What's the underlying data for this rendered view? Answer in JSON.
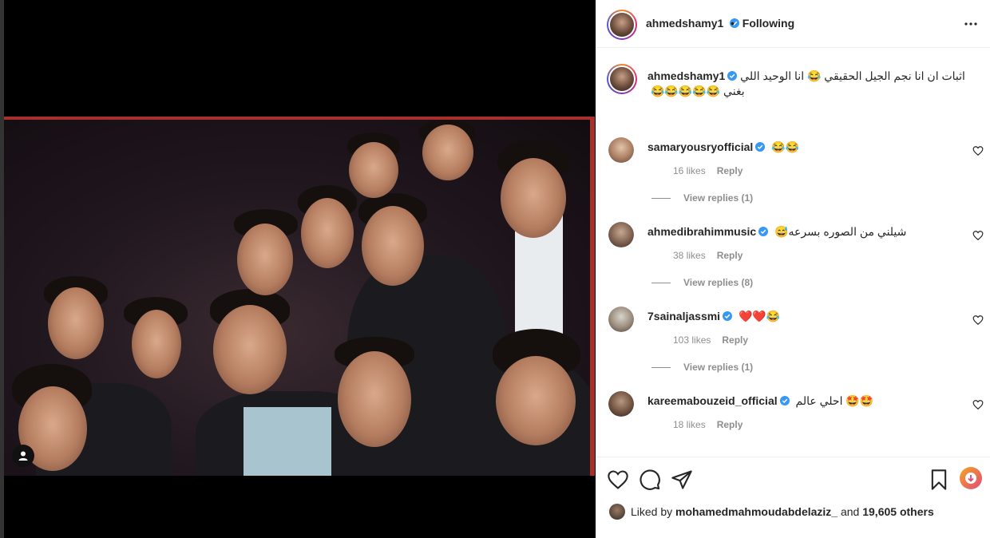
{
  "post": {
    "username": "ahmedshamy1",
    "follow_status": "Following",
    "separator": "•",
    "caption": "اثبات ان انا نجم الجيل الحقيقي 😂 انا الوحيد اللي بغني 😂😂😂😂😂"
  },
  "comments": [
    {
      "username": "samaryousryofficial",
      "text": "😂😂",
      "likes": "16 likes",
      "reply": "Reply",
      "replies": "View replies (1)"
    },
    {
      "username": "ahmedibrahimmusic",
      "text": "شيلني من الصوره بسرعه😅",
      "likes": "38 likes",
      "reply": "Reply",
      "replies": "View replies (8)"
    },
    {
      "username": "7sainaljassmi",
      "text": "❤️❤️😂",
      "likes": "103 likes",
      "reply": "Reply",
      "replies": "View replies (1)"
    },
    {
      "username": "kareemabouzeid_official",
      "text": "احلي عالم 🤩🤩",
      "likes": "18 likes",
      "reply": "Reply",
      "replies": ""
    }
  ],
  "likes": {
    "prefix": "Liked by",
    "user": "mohamedmahmoudabdelaziz_",
    "conj": "and",
    "others": "19,605 others"
  },
  "icons": {
    "verified": "verified-badge-icon",
    "more": "more-options-icon",
    "heart": "heart-icon",
    "comment": "comment-icon",
    "share": "share-icon",
    "save": "bookmark-icon",
    "tag": "user-tag-icon"
  },
  "colors": {
    "verified": "#3897f0",
    "text": "#262626",
    "muted": "#8e8e8e",
    "frame": "#a8302c"
  }
}
